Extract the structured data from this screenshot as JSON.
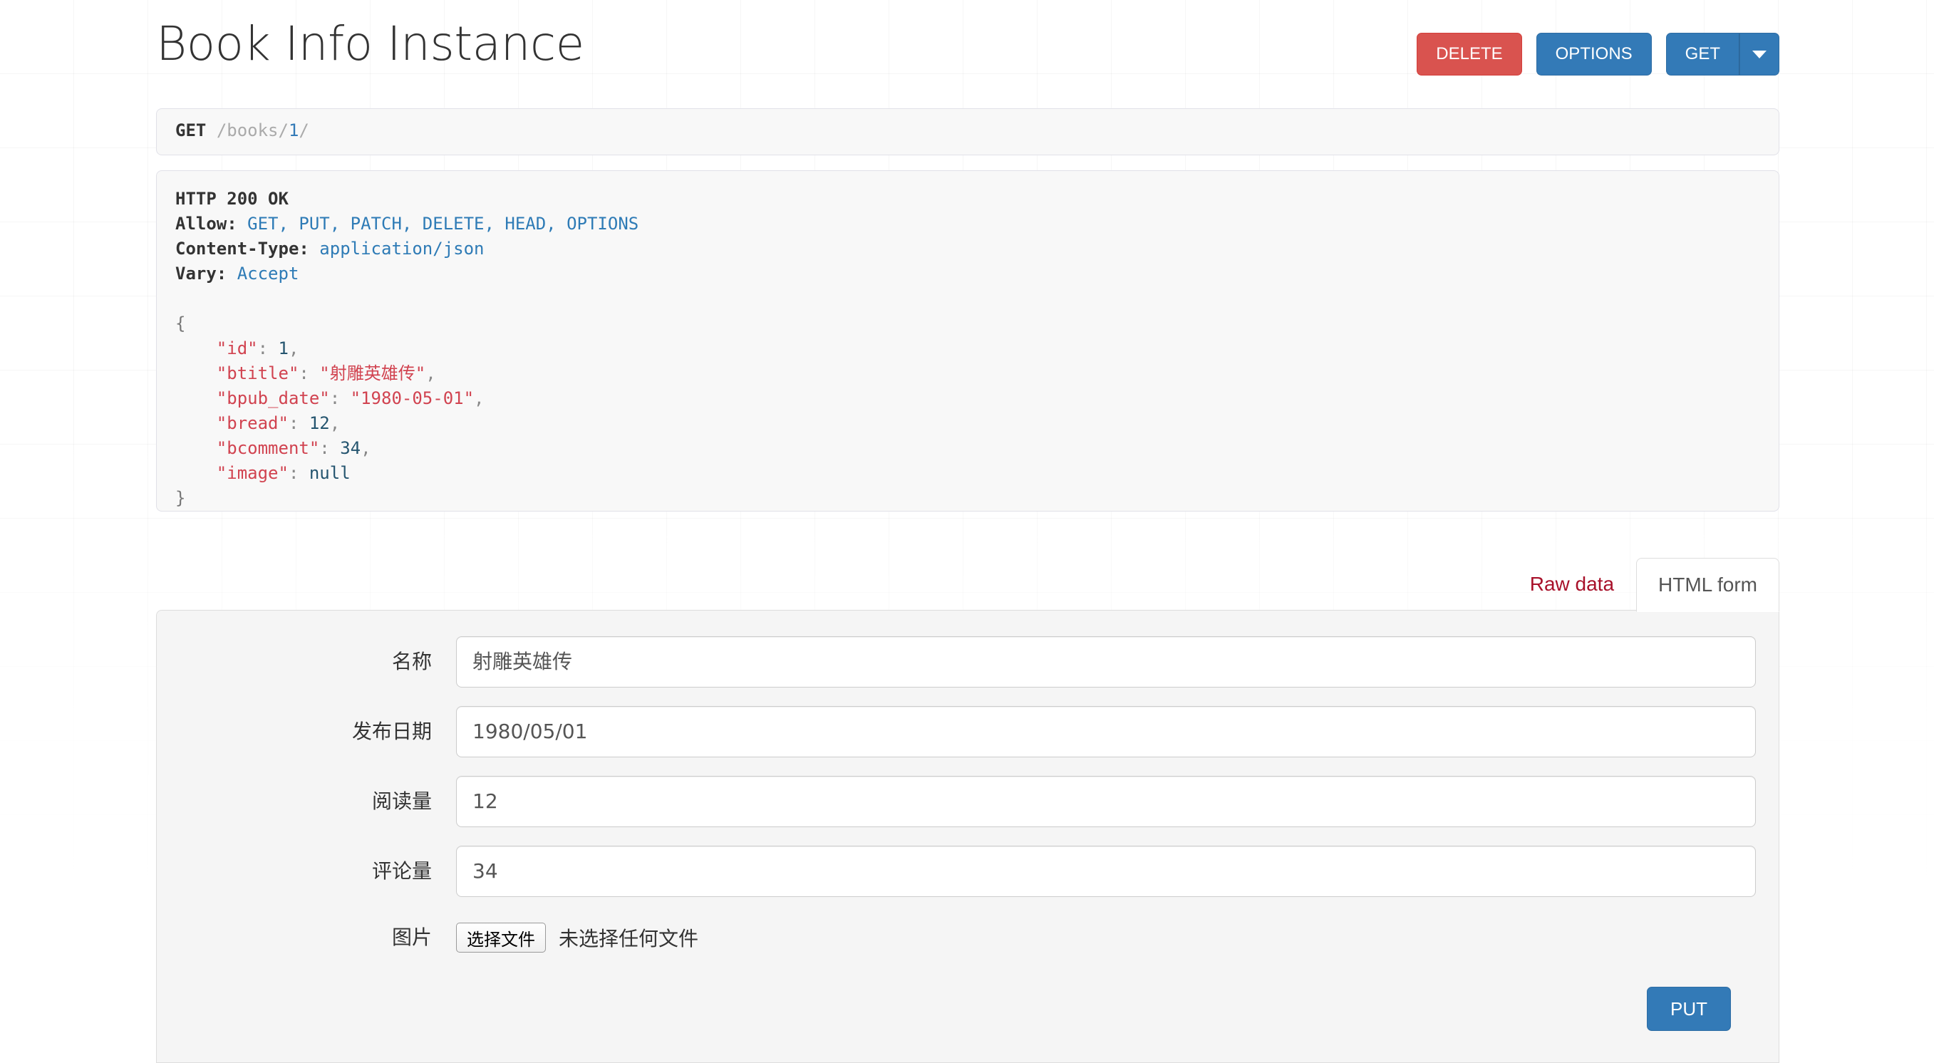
{
  "header": {
    "title": "Book Info Instance",
    "buttons": [
      {
        "label": "DELETE",
        "style": "danger",
        "name": "delete-button"
      },
      {
        "label": "OPTIONS",
        "style": "primary",
        "name": "options-button"
      },
      {
        "label": "GET",
        "style": "primary",
        "name": "get-button"
      }
    ],
    "dropdown_icon": "chevron-down-icon"
  },
  "request": {
    "method": "GET",
    "path_prefix": "/books/",
    "path_pk": "1",
    "path_suffix": "/"
  },
  "response": {
    "status_line": "HTTP 200 OK",
    "headers": [
      {
        "name": "Allow:",
        "value": "GET, PUT, PATCH, DELETE, HEAD, OPTIONS"
      },
      {
        "name": "Content-Type:",
        "value": "application/json"
      },
      {
        "name": "Vary:",
        "value": "Accept"
      }
    ],
    "body": {
      "open_brace": "{",
      "close_brace": "}",
      "fields": [
        {
          "key": "\"id\"",
          "value": "1",
          "type": "num",
          "comma": ","
        },
        {
          "key": "\"btitle\"",
          "value": "\"射雕英雄传\"",
          "type": "str",
          "comma": ","
        },
        {
          "key": "\"bpub_date\"",
          "value": "\"1980-05-01\"",
          "type": "str",
          "comma": ","
        },
        {
          "key": "\"bread\"",
          "value": "12",
          "type": "num",
          "comma": ","
        },
        {
          "key": "\"bcomment\"",
          "value": "34",
          "type": "num",
          "comma": ","
        },
        {
          "key": "\"image\"",
          "value": "null",
          "type": "null",
          "comma": ""
        }
      ]
    }
  },
  "tabs": [
    {
      "label": "Raw data",
      "active": false,
      "name": "tab-raw-data"
    },
    {
      "label": "HTML form",
      "active": true,
      "name": "tab-html-form"
    }
  ],
  "form": {
    "fields": [
      {
        "label": "名称",
        "value": "射雕英雄传",
        "name": "btitle-field"
      },
      {
        "label": "发布日期",
        "value": "1980/05/01",
        "name": "bpub-date-field"
      },
      {
        "label": "阅读量",
        "value": "12",
        "name": "bread-field"
      },
      {
        "label": "评论量",
        "value": "34",
        "name": "bcomment-field"
      }
    ],
    "file_field": {
      "label": "图片",
      "button_label": "选择文件",
      "status_text": "未选择任何文件"
    },
    "submit": {
      "label": "PUT",
      "name": "put-button"
    }
  },
  "colors": {
    "danger": "#d9534f",
    "primary": "#337ab7",
    "link_red": "#a8112a",
    "json_key": "#d14350",
    "json_num": "#25556f",
    "header_value": "#2e7bb6"
  }
}
